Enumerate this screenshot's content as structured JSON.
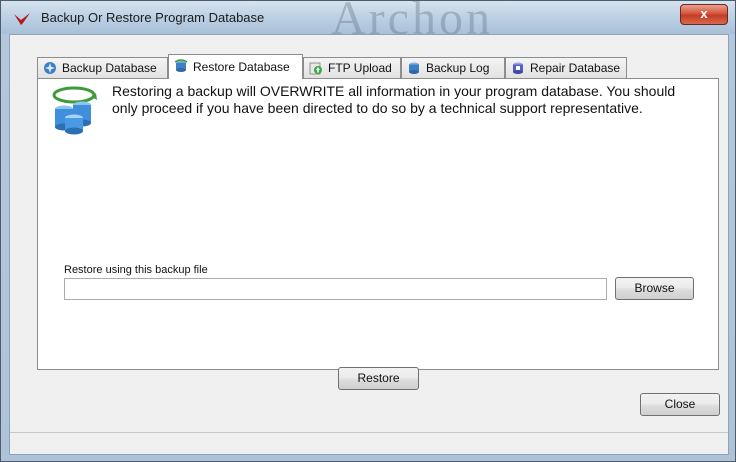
{
  "window": {
    "title": "Backup Or Restore Program Database",
    "watermark": "Archon",
    "close_glyph": "x"
  },
  "tabs": [
    {
      "label": "Backup Database",
      "icon": "database-backup-icon",
      "active": false
    },
    {
      "label": "Restore Database",
      "icon": "database-restore-icon",
      "active": true
    },
    {
      "label": "FTP Upload",
      "icon": "ftp-upload-icon",
      "active": false
    },
    {
      "label": "Backup Log",
      "icon": "backup-log-icon",
      "active": false
    },
    {
      "label": "Repair Database",
      "icon": "repair-database-icon",
      "active": false
    }
  ],
  "restore": {
    "warning": "Restoring a backup will OVERWRITE all information in your program database.  You should only proceed if you have been directed to do so by a technical support representative.",
    "file_label": "Restore using this backup file",
    "file_value": "",
    "browse_label": "Browse",
    "restore_label": "Restore"
  },
  "footer": {
    "close_label": "Close"
  },
  "colors": {
    "title_bar": "#bcd0e4",
    "close_button": "#c43c22",
    "panel_background": "#ffffff",
    "dialog_background": "#f0f0f0"
  }
}
